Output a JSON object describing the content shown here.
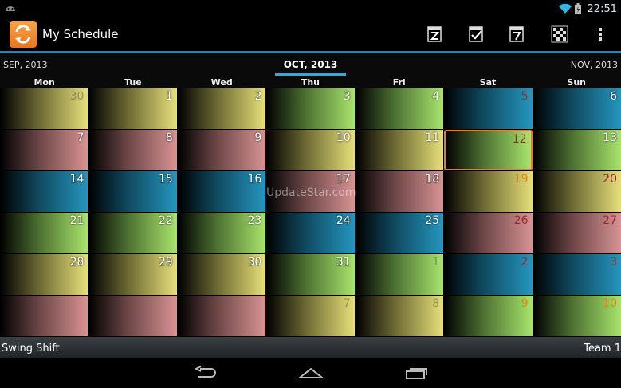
{
  "status": {
    "time": "22:51"
  },
  "app": {
    "title": "My Schedule"
  },
  "months": {
    "prev": "SEP, 2013",
    "current": "OCT, 2013",
    "next": "NOV, 2013"
  },
  "weekdays": [
    "Mon",
    "Tue",
    "Wed",
    "Thu",
    "Fri",
    "Sat",
    "Sun"
  ],
  "weeks": [
    [
      {
        "n": "30",
        "c": "yellow",
        "out": true
      },
      {
        "n": "1",
        "c": "yellow"
      },
      {
        "n": "2",
        "c": "yellow"
      },
      {
        "n": "3",
        "c": "green"
      },
      {
        "n": "4",
        "c": "green"
      },
      {
        "n": "5",
        "c": "blue",
        "tone": "dark"
      },
      {
        "n": "6",
        "c": "blue"
      }
    ],
    [
      {
        "n": "7",
        "c": "pink"
      },
      {
        "n": "8",
        "c": "pink"
      },
      {
        "n": "9",
        "c": "pink"
      },
      {
        "n": "10",
        "c": "yellow"
      },
      {
        "n": "11",
        "c": "yellow"
      },
      {
        "n": "12",
        "c": "green",
        "selected": true,
        "tone": "dark"
      },
      {
        "n": "13",
        "c": "green"
      }
    ],
    [
      {
        "n": "14",
        "c": "blue"
      },
      {
        "n": "15",
        "c": "blue"
      },
      {
        "n": "16",
        "c": "blue"
      },
      {
        "n": "17",
        "c": "pink"
      },
      {
        "n": "18",
        "c": "pink"
      },
      {
        "n": "19",
        "c": "yellow",
        "tone": "orange"
      },
      {
        "n": "20",
        "c": "yellow",
        "tone": "dark"
      }
    ],
    [
      {
        "n": "21",
        "c": "green"
      },
      {
        "n": "22",
        "c": "green"
      },
      {
        "n": "23",
        "c": "green"
      },
      {
        "n": "24",
        "c": "blue"
      },
      {
        "n": "25",
        "c": "blue"
      },
      {
        "n": "26",
        "c": "pink",
        "tone": "dark"
      },
      {
        "n": "27",
        "c": "pink",
        "tone": "dark"
      }
    ],
    [
      {
        "n": "28",
        "c": "yellow"
      },
      {
        "n": "29",
        "c": "yellow"
      },
      {
        "n": "30",
        "c": "yellow"
      },
      {
        "n": "31",
        "c": "green"
      },
      {
        "n": "1",
        "c": "green",
        "out": true
      },
      {
        "n": "2",
        "c": "blue",
        "tone": "dark"
      },
      {
        "n": "3",
        "c": "blue",
        "tone": "dark"
      }
    ],
    [
      {
        "n": "",
        "c": "pink"
      },
      {
        "n": "",
        "c": "pink"
      },
      {
        "n": "",
        "c": "pink"
      },
      {
        "n": "7",
        "c": "yellow",
        "out": true
      },
      {
        "n": "8",
        "c": "yellow",
        "out": true
      },
      {
        "n": "9",
        "c": "green",
        "tone": "orange"
      },
      {
        "n": "10",
        "c": "green",
        "tone": "orange"
      }
    ]
  ],
  "footer": {
    "shift": "Swing Shift",
    "team": "Team 1"
  },
  "watermark": "UpdateStar.com",
  "colors": {
    "accent": "#33a9d8",
    "selected_border": "#f07a20",
    "logo": "#e8751f"
  },
  "icons": [
    "android-icon",
    "wifi-icon",
    "battery-icon",
    "refresh-logo-icon",
    "date-z-icon",
    "checkbox-icon",
    "date-7-icon",
    "pattern-icon",
    "overflow-menu-icon",
    "back-icon",
    "home-icon",
    "recent-apps-icon"
  ]
}
